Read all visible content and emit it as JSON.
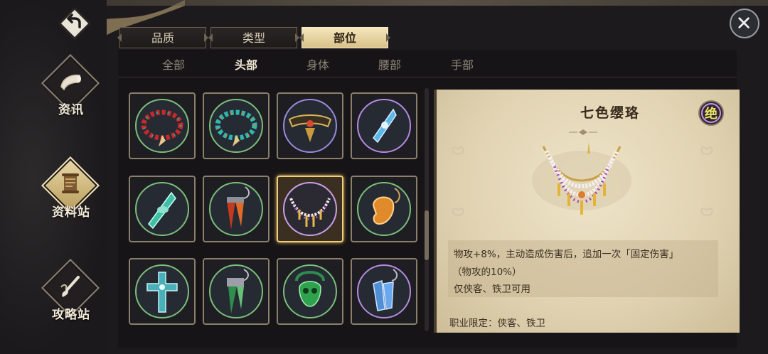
{
  "nav": {
    "items": [
      {
        "label": "资讯",
        "icon": "horn-icon",
        "active": false
      },
      {
        "label": "资料站",
        "icon": "scroll-icon",
        "active": true
      },
      {
        "label": "攻略站",
        "icon": "brush-icon",
        "active": false
      }
    ]
  },
  "tabs": [
    {
      "label": "品质",
      "active": false
    },
    {
      "label": "类型",
      "active": false
    },
    {
      "label": "部位",
      "active": true
    }
  ],
  "subtabs": [
    {
      "label": "全部",
      "active": false
    },
    {
      "label": "头部",
      "active": true
    },
    {
      "label": "身体",
      "active": false
    },
    {
      "label": "腰部",
      "active": false
    },
    {
      "label": "手部",
      "active": false
    }
  ],
  "items": [
    {
      "name": "red-bead-necklace-icon",
      "selected": false
    },
    {
      "name": "teal-bead-necklace-icon",
      "selected": false
    },
    {
      "name": "gold-circlet-icon",
      "selected": false
    },
    {
      "name": "blue-crystal-pendant-icon",
      "selected": false
    },
    {
      "name": "jade-crystal-pendant-icon",
      "selected": false
    },
    {
      "name": "red-fang-pendant-icon",
      "selected": false
    },
    {
      "name": "seven-color-necklace-icon",
      "selected": true
    },
    {
      "name": "amber-charm-icon",
      "selected": false
    },
    {
      "name": "cross-amulet-icon",
      "selected": false
    },
    {
      "name": "green-fang-pendant-icon",
      "selected": false
    },
    {
      "name": "green-skull-amulet-icon",
      "selected": false
    },
    {
      "name": "blue-tassel-charm-icon",
      "selected": false
    }
  ],
  "detail": {
    "title": "七色缨珞",
    "rank": "绝",
    "desc_line1": "物攻+8%，主动造成伤害后，追加一次「固定伤害」",
    "desc_line2": "（物攻的10%）",
    "desc_line3": "仅侠客、铁卫可用",
    "limit": "职业限定：侠客、铁卫"
  },
  "colors": {
    "parchment": "#e6d9bb",
    "gold_accent": "#f0cf7a",
    "tab_active": "#e5d19f"
  }
}
